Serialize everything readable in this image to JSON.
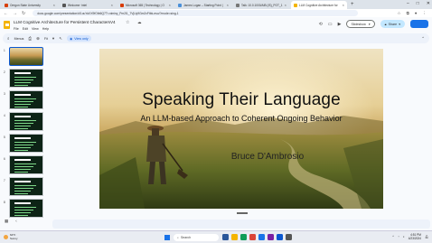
{
  "browser": {
    "tabs": [
      {
        "title": "Oregon State University",
        "fav_color": "#d73f09",
        "active": false
      },
      {
        "title": "Welcome ·intel",
        "fav_color": "#555555",
        "active": false
      },
      {
        "title": "Microsoft 365 | Technology | O",
        "fav_color": "#d83b01",
        "active": false
      },
      {
        "title": "James Logan – Starting Point |",
        "fav_color": "#4a90d9",
        "active": false
      },
      {
        "title": "Talk: 10.0.1000/AIB (IS)_POT_1",
        "fav_color": "#777777",
        "active": false
      },
      {
        "title": "LLM Cognitive Architecture for",
        "fav_color": "#f4b400",
        "active": true
      }
    ],
    "new_tab": "+",
    "url": "docs.google.com/presentation/d/1ouYaXX9fOtb6Q7Tr-niminy_Pm2l1_7VjUy9Gm2xFtbk-esu/?mode=sing-1",
    "window_controls": {
      "minimize": "–",
      "maximize": "□",
      "close": "✕"
    }
  },
  "doc": {
    "title": "LLM Cognitive Architecture for Persistent CharactersV4",
    "menu": [
      "File",
      "Edit",
      "View",
      "Help"
    ],
    "slideshow_label": "Slideshow",
    "share_label": "Share"
  },
  "toolbar": {
    "menus_label": "Menus",
    "zoom_label": "Fit",
    "view_only_label": "View only"
  },
  "filmstrip": {
    "slides": [
      {
        "num": "1",
        "kind": "photo"
      },
      {
        "num": "2",
        "kind": "dark"
      },
      {
        "num": "3",
        "kind": "dark"
      },
      {
        "num": "4",
        "kind": "dark"
      },
      {
        "num": "5",
        "kind": "dark"
      },
      {
        "num": "6",
        "kind": "dark"
      },
      {
        "num": "7",
        "kind": "dark"
      },
      {
        "num": "8",
        "kind": "dark"
      }
    ],
    "selected": 0
  },
  "slide": {
    "title": "Speaking Their Language",
    "subtitle": "An LLM-based Approach to Coherent Ongoing Behavior",
    "author": "Bruce D'Ambrosio"
  },
  "taskbar": {
    "weather_temp": "64°F",
    "weather_desc": "Sunny",
    "search_placeholder": "Search",
    "apps": [
      "#2b579a",
      "#f4b400",
      "#0f9d58",
      "#db4437",
      "#1a73e8",
      "#7b1fa2",
      "#0b57d0",
      "#555555"
    ],
    "time": "4:51 PM",
    "date": "4/23/2024"
  }
}
